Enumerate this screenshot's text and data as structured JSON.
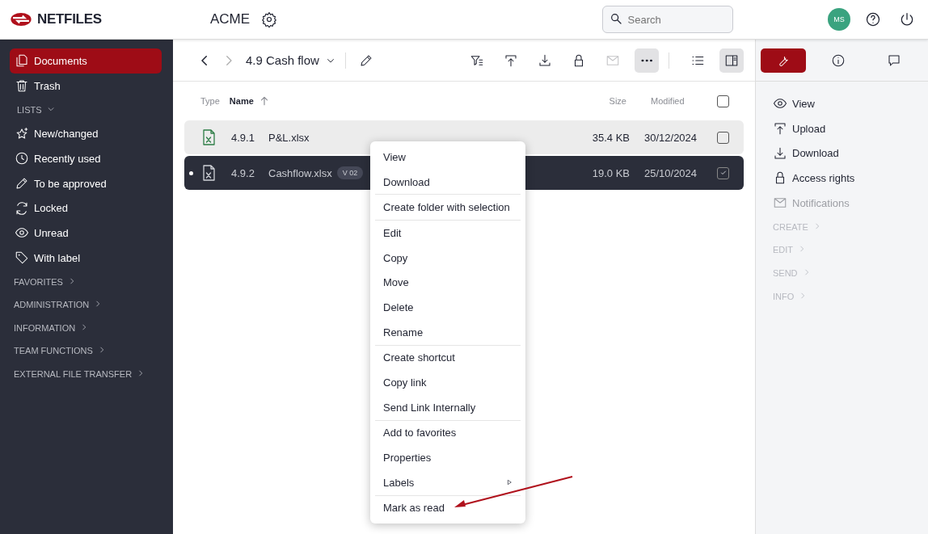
{
  "header": {
    "logo": "NETFILES",
    "workspace": "ACME",
    "search": {
      "placeholder": "Search"
    },
    "avatar": "MS"
  },
  "sidebar": {
    "items": [
      {
        "label": "Documents",
        "selected": true
      },
      {
        "label": "Trash",
        "selected": false
      }
    ],
    "lists": {
      "label": "LISTS",
      "expanded": true,
      "items": [
        {
          "label": "New/changed",
          "selected": false
        },
        {
          "label": "Recently used",
          "selected": false
        },
        {
          "label": "To be approved",
          "selected": false
        },
        {
          "label": "Locked",
          "selected": false
        },
        {
          "label": "Unread",
          "selected": false
        },
        {
          "label": "With label",
          "selected": false
        }
      ]
    },
    "sections": [
      {
        "label": "FAVORITES",
        "expanded": false
      },
      {
        "label": "ADMINISTRATION",
        "expanded": false
      },
      {
        "label": "INFORMATION",
        "expanded": false
      },
      {
        "label": "TEAM FUNCTIONS",
        "expanded": false
      },
      {
        "label": "EXTERNAL FILE TRANSFER",
        "expanded": false
      }
    ]
  },
  "toolbar": {
    "folder": "4.9 Cash flow",
    "buttons": [
      {
        "disabled": false,
        "selected": false
      },
      {
        "disabled": false,
        "selected": false
      },
      {
        "disabled": false,
        "selected": false
      },
      {
        "disabled": false,
        "selected": false
      },
      {
        "disabled": true,
        "selected": false
      },
      {
        "disabled": false,
        "selected": true
      },
      {
        "disabled": false,
        "selected": false
      },
      {
        "disabled": false,
        "selected": true
      }
    ]
  },
  "table": {
    "columns": [
      "Type",
      "Name",
      "Size",
      "Modified"
    ],
    "all_checked": false,
    "rows": [
      {
        "number": "4.9.1",
        "name": "P&L.xlsx",
        "version": "",
        "size": "35.4 KB",
        "modified": "30/12/2024",
        "selected": false,
        "hovered": true,
        "checked": false,
        "unread": false
      },
      {
        "number": "4.9.2",
        "name": "Cashflow.xlsx",
        "version": "V 02",
        "size": "19.0 KB",
        "modified": "25/10/2024",
        "selected": true,
        "hovered": false,
        "checked": true,
        "unread": true
      }
    ]
  },
  "context_menu": {
    "groups": [
      [
        {
          "label": "View",
          "submenu": false
        },
        {
          "label": "Download",
          "submenu": false
        }
      ],
      [
        {
          "label": "Create folder with selection",
          "submenu": false
        }
      ],
      [
        {
          "label": "Edit",
          "submenu": false
        },
        {
          "label": "Copy",
          "submenu": false
        },
        {
          "label": "Move",
          "submenu": false
        },
        {
          "label": "Delete",
          "submenu": false
        },
        {
          "label": "Rename",
          "submenu": false
        }
      ],
      [
        {
          "label": "Create shortcut",
          "submenu": false
        },
        {
          "label": "Copy link",
          "submenu": false
        },
        {
          "label": "Send Link Internally",
          "submenu": false
        }
      ],
      [
        {
          "label": "Add to favorites",
          "submenu": false
        },
        {
          "label": "Properties",
          "submenu": false
        },
        {
          "label": "Labels",
          "submenu": true
        }
      ],
      [
        {
          "label": "Mark as read",
          "submenu": false
        }
      ]
    ]
  },
  "right_panel": {
    "tabs": [
      {
        "selected": true
      },
      {
        "selected": false
      },
      {
        "selected": false
      }
    ],
    "actions": [
      {
        "label": "View",
        "disabled": false
      },
      {
        "label": "Upload",
        "disabled": false
      },
      {
        "label": "Download",
        "disabled": false
      },
      {
        "label": "Access rights",
        "disabled": false
      },
      {
        "label": "Notifications",
        "disabled": true
      }
    ],
    "sections": [
      {
        "label": "CREATE",
        "expanded": false
      },
      {
        "label": "EDIT",
        "expanded": false
      },
      {
        "label": "SEND",
        "expanded": false
      },
      {
        "label": "INFO",
        "expanded": false
      }
    ]
  }
}
